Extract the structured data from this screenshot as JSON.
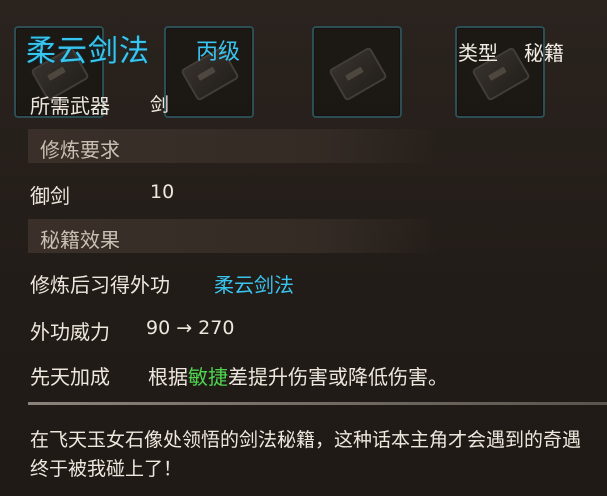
{
  "item": {
    "title": "柔云剑法",
    "grade": "丙级",
    "type_label": "类型",
    "type_value": "秘籍"
  },
  "weapon": {
    "label": "所需武器",
    "value": "剑"
  },
  "requirements": {
    "header": "修炼要求",
    "skill": "御剑",
    "value": "10"
  },
  "effects": {
    "header": "秘籍效果",
    "learn_label": "修炼后习得外功",
    "learn_value": "柔云剑法",
    "power_label": "外功威力",
    "power_value": "90 → 270",
    "innate_label": "先天加成",
    "innate_prefix": "根据",
    "innate_highlight": "敏捷",
    "innate_suffix": "差提升伤害或降低伤害。"
  },
  "description": "在飞天玉女石像处领悟的剑法秘籍，这种话本主角才会遇到的奇遇终于被我碰上了！",
  "colors": {
    "title": "#38c5f0",
    "highlight": "#4fd34f"
  }
}
